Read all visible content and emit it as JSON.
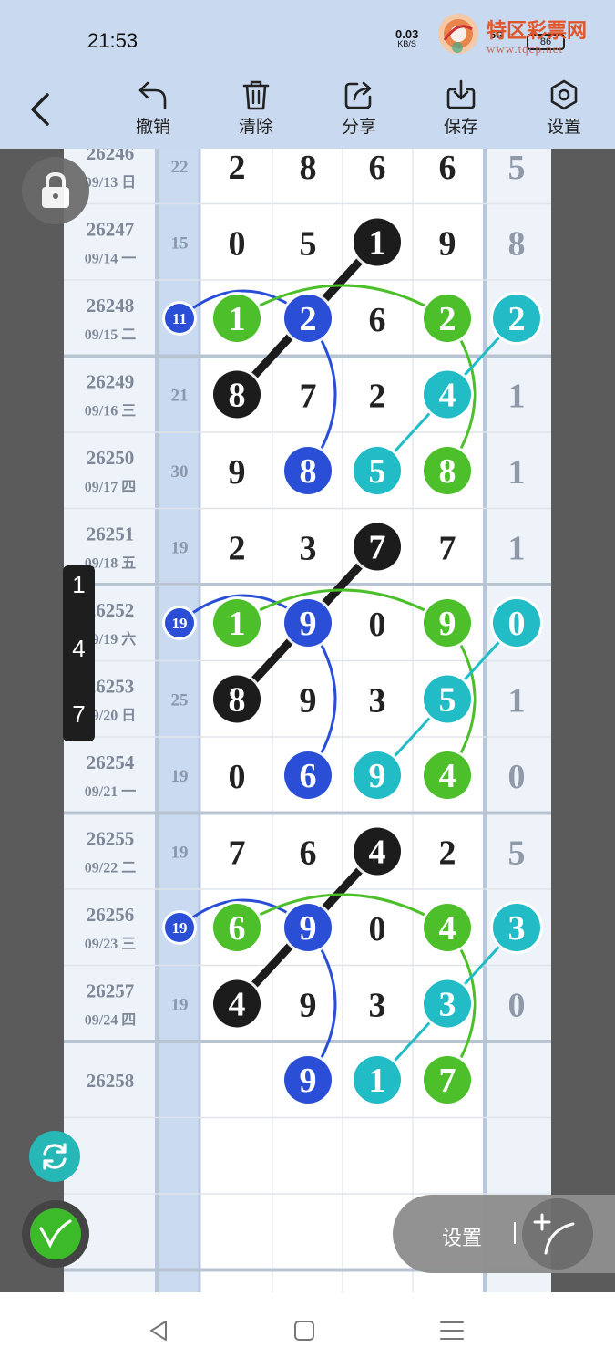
{
  "status": {
    "time": "21:53",
    "net_speed": "0.03",
    "net_unit": "KB/S",
    "signal": "5G",
    "hd": "HD",
    "battery": "86"
  },
  "watermark": {
    "text": "特区彩票网",
    "url": "www.tqcp.net"
  },
  "toolbar": {
    "undo": "撤销",
    "clear": "清除",
    "share": "分享",
    "save": "保存",
    "settings": "设置"
  },
  "rows": [
    {
      "issue": "26246",
      "date": "09/13 日",
      "sum": "22",
      "d": [
        "2",
        "8",
        "6",
        "6"
      ],
      "last": "5"
    },
    {
      "issue": "26247",
      "date": "09/14 一",
      "sum": "15",
      "d": [
        "0",
        "5",
        "1",
        "9"
      ],
      "last": "8"
    },
    {
      "issue": "26248",
      "date": "09/15 二",
      "sum": "11",
      "d": [
        "1",
        "2",
        "6",
        "2"
      ],
      "last": "2"
    },
    {
      "issue": "26249",
      "date": "09/16 三",
      "sum": "21",
      "d": [
        "8",
        "7",
        "2",
        "4"
      ],
      "last": "1"
    },
    {
      "issue": "26250",
      "date": "09/17 四",
      "sum": "30",
      "d": [
        "9",
        "8",
        "5",
        "8"
      ],
      "last": "1"
    },
    {
      "issue": "26251",
      "date": "09/18 五",
      "sum": "19",
      "d": [
        "2",
        "3",
        "7",
        "7"
      ],
      "last": "1"
    },
    {
      "issue": "26252",
      "date": "09/19 六",
      "sum": "19",
      "d": [
        "1",
        "9",
        "0",
        "9"
      ],
      "last": "0"
    },
    {
      "issue": "26253",
      "date": "09/20 日",
      "sum": "25",
      "d": [
        "8",
        "9",
        "3",
        "5"
      ],
      "last": "1"
    },
    {
      "issue": "26254",
      "date": "09/21 一",
      "sum": "19",
      "d": [
        "0",
        "6",
        "9",
        "4"
      ],
      "last": "0"
    },
    {
      "issue": "26255",
      "date": "09/22 二",
      "sum": "19",
      "d": [
        "7",
        "6",
        "4",
        "2"
      ],
      "last": "5"
    },
    {
      "issue": "26256",
      "date": "09/23 三",
      "sum": "19",
      "d": [
        "6",
        "9",
        "0",
        "4"
      ],
      "last": "3"
    },
    {
      "issue": "26257",
      "date": "09/24 四",
      "sum": "19",
      "d": [
        "4",
        "9",
        "3",
        "3"
      ],
      "last": "0"
    },
    {
      "issue": "26258",
      "date": "",
      "sum": "",
      "d": [
        "",
        "9",
        "1",
        "7"
      ],
      "last": ""
    },
    {
      "issue": "",
      "date": "",
      "sum": "",
      "d": [
        "",
        "",
        "",
        ""
      ],
      "last": ""
    },
    {
      "issue": "",
      "date": "",
      "sum": "",
      "d": [
        "",
        "",
        "",
        ""
      ],
      "last": ""
    }
  ],
  "circles": [
    {
      "row": 1,
      "col": 2,
      "color": "black"
    },
    {
      "row": 2,
      "col": -1,
      "color": "blue",
      "small": true
    },
    {
      "row": 2,
      "col": 0,
      "color": "green"
    },
    {
      "row": 2,
      "col": 1,
      "color": "blue"
    },
    {
      "row": 2,
      "col": 3,
      "color": "green"
    },
    {
      "row": 2,
      "col": 4,
      "color": "teal"
    },
    {
      "row": 3,
      "col": 0,
      "color": "black"
    },
    {
      "row": 3,
      "col": 3,
      "color": "teal"
    },
    {
      "row": 4,
      "col": 1,
      "color": "blue"
    },
    {
      "row": 4,
      "col": 2,
      "color": "teal"
    },
    {
      "row": 4,
      "col": 3,
      "color": "green"
    },
    {
      "row": 5,
      "col": 2,
      "color": "black"
    },
    {
      "row": 6,
      "col": -1,
      "color": "blue",
      "small": true
    },
    {
      "row": 6,
      "col": 0,
      "color": "green"
    },
    {
      "row": 6,
      "col": 1,
      "color": "blue"
    },
    {
      "row": 6,
      "col": 3,
      "color": "green"
    },
    {
      "row": 6,
      "col": 4,
      "color": "teal"
    },
    {
      "row": 7,
      "col": 0,
      "color": "black"
    },
    {
      "row": 7,
      "col": 3,
      "color": "teal"
    },
    {
      "row": 8,
      "col": 1,
      "color": "blue"
    },
    {
      "row": 8,
      "col": 2,
      "color": "teal"
    },
    {
      "row": 8,
      "col": 3,
      "color": "green"
    },
    {
      "row": 9,
      "col": 2,
      "color": "black"
    },
    {
      "row": 10,
      "col": -1,
      "color": "blue",
      "small": true
    },
    {
      "row": 10,
      "col": 0,
      "color": "green"
    },
    {
      "row": 10,
      "col": 1,
      "color": "blue"
    },
    {
      "row": 10,
      "col": 3,
      "color": "green"
    },
    {
      "row": 10,
      "col": 4,
      "color": "teal"
    },
    {
      "row": 11,
      "col": 0,
      "color": "black"
    },
    {
      "row": 11,
      "col": 3,
      "color": "teal"
    },
    {
      "row": 12,
      "col": 1,
      "color": "blue"
    },
    {
      "row": 12,
      "col": 2,
      "color": "teal"
    },
    {
      "row": 12,
      "col": 3,
      "color": "green"
    }
  ],
  "colors": {
    "black": "#1c1c1c",
    "blue": "#2a4fd6",
    "green": "#4cbf2a",
    "teal": "#21bcc6",
    "digit": "#222222",
    "lastcol": "#8f99a8",
    "sumcol": "#8b97aa",
    "issue": "#7e8898"
  },
  "side_numbers": [
    "1",
    "4",
    "7"
  ],
  "pill": {
    "label": "设置"
  }
}
